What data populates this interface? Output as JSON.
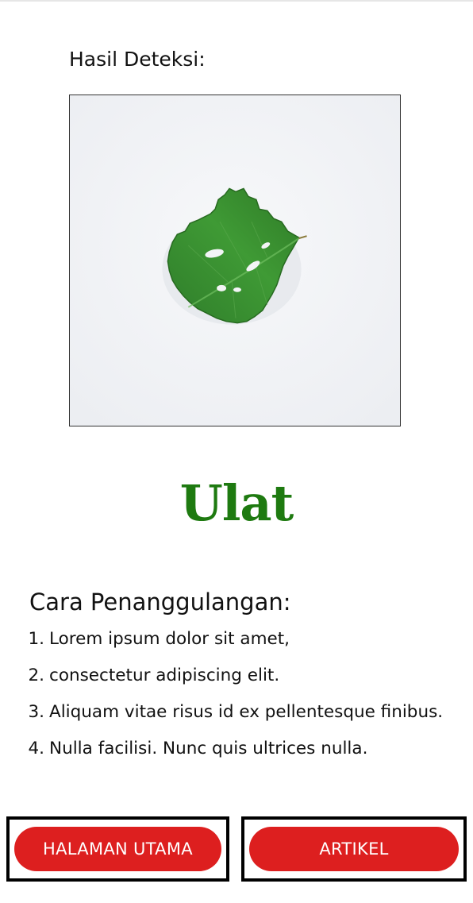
{
  "detection": {
    "label": "Hasil Deteksi:",
    "image_subject": "strawberry-leaf-with-caterpillar-holes"
  },
  "result": {
    "title": "Ulat",
    "title_color": "#1e7a10"
  },
  "treatment": {
    "heading": "Cara Penanggulangan:",
    "steps": [
      {
        "number": "1.",
        "text": "Lorem ipsum dolor sit amet,"
      },
      {
        "number": "2.",
        "text": "consectetur adipiscing elit."
      },
      {
        "number": "3.",
        "text": "Aliquam vitae risus id ex pellentesque finibus."
      },
      {
        "number": "4.",
        "text": "Nulla facilisi. Nunc quis ultrices nulla."
      }
    ]
  },
  "buttons": {
    "home_label": "HALAMAN UTAMA",
    "article_label": "ARTIKEL",
    "color": "#dd1f1f"
  }
}
